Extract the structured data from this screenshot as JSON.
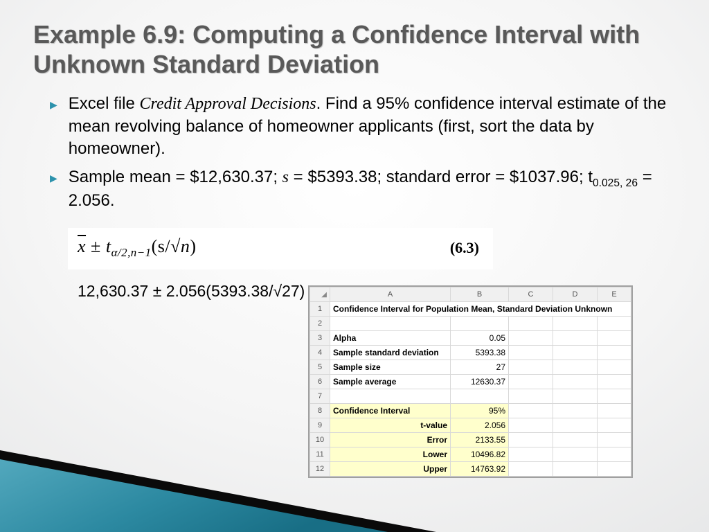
{
  "title": "Example 6.9: Computing a Confidence Interval with Unknown Standard Deviation",
  "bullets": {
    "b1_pre": "Excel file ",
    "b1_italic": "Credit Approval Decisions",
    "b1_post": ". Find a 95% confidence interval estimate of the mean revolving balance of homeowner applicants (first, sort the data by homeowner).",
    "b2_a": "Sample mean = $12,630.37; ",
    "b2_s": "s",
    "b2_b": " = $5393.38; standard error = $1037.96; t",
    "b2_sub": "0.025, 26",
    "b2_c": " = 2.056."
  },
  "formula": {
    "xbar": "x",
    "pm": " ± ",
    "t": " t",
    "sub": "α/2,n−1",
    "paren": "(s/√",
    "n": "n",
    "close": ")",
    "num": "(6.3)"
  },
  "calc": "12,630.37 ± 2.056(5393.38/√27)",
  "excel": {
    "cols": {
      "a": "A",
      "b": "B",
      "c": "C",
      "d": "D",
      "e": "E"
    },
    "rows": {
      "r1": "Confidence Interval for Population Mean, Standard Deviation Unknown",
      "r3a": "Alpha",
      "r3b": "0.05",
      "r4a": "Sample standard deviation",
      "r4b": "5393.38",
      "r5a": "Sample size",
      "r5b": "27",
      "r6a": "Sample average",
      "r6b": "12630.37",
      "r8a": "Confidence Interval",
      "r8b": "95%",
      "r9a": "t-value",
      "r9b": "2.056",
      "r10a": "Error",
      "r10b": "2133.55",
      "r11a": "Lower",
      "r11b": "10496.82",
      "r12a": "Upper",
      "r12b": "14763.92"
    }
  }
}
